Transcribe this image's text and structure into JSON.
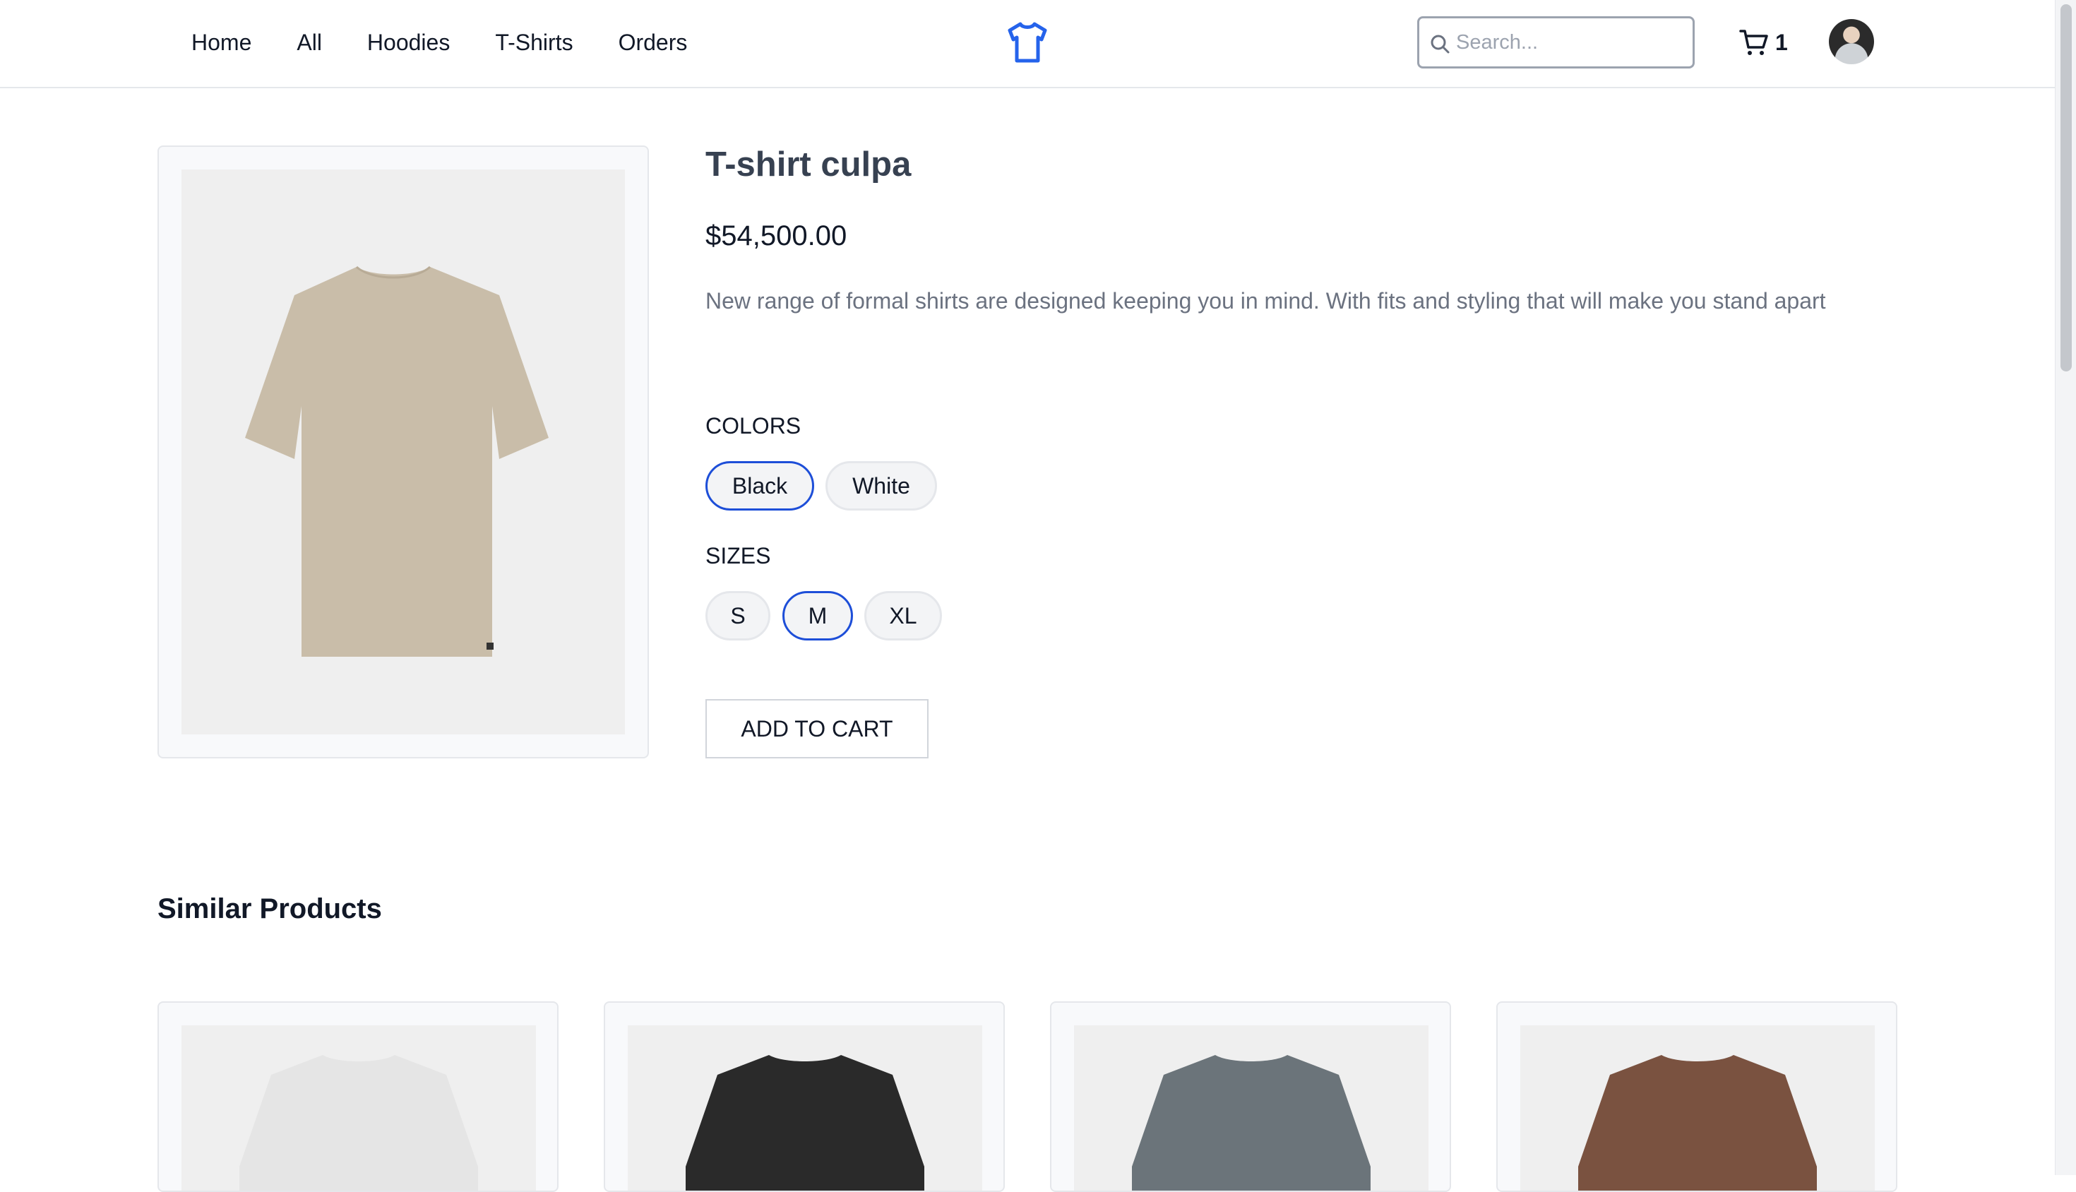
{
  "nav": {
    "items": [
      "Home",
      "All",
      "Hoodies",
      "T-Shirts",
      "Orders"
    ]
  },
  "search": {
    "placeholder": "Search..."
  },
  "cart": {
    "count": "1"
  },
  "product": {
    "title": "T-shirt culpa",
    "price": "$54,500.00",
    "description": "New range of formal shirts are designed keeping you in mind. With fits and styling that will make you stand apart",
    "colors_label": "COLORS",
    "colors": [
      "Black",
      "White"
    ],
    "selected_color": "Black",
    "sizes_label": "SIZES",
    "sizes": [
      "S",
      "M",
      "XL"
    ],
    "selected_size": "M",
    "add_to_cart": "ADD TO CART",
    "shirt_color": "#c9bda9"
  },
  "similar": {
    "title": "Similar Products",
    "shirt_colors": [
      "#e5e5e5",
      "#2a2a2a",
      "#6b747a",
      "#7a5240"
    ]
  },
  "colors": {
    "accent": "#1d4ed8",
    "logo": "#2563eb"
  }
}
